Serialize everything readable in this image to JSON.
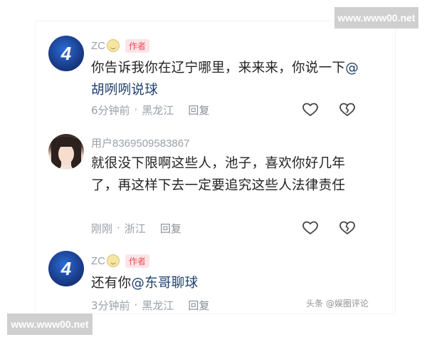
{
  "watermarks": {
    "top": "www.www00.net",
    "bottom": "www.www00.net",
    "source": "头条 @娱圈评论"
  },
  "comments": [
    {
      "username": "ZC",
      "badge": "作者",
      "text_plain": "你告诉我你在辽宁哪里，来来来，你说一下",
      "mention": "@胡咧咧说球",
      "time": "6分钟前",
      "location": "黑龙江",
      "reply_label": "回复",
      "avatar_text": "4"
    },
    {
      "username": "用户8369509583867",
      "badge": "",
      "text_plain": "就很没下限啊这些人，池子，喜欢你好几年了，再这样下去一定要追究这些人法律责任",
      "mention": "",
      "time": "刚刚",
      "location": "浙江",
      "reply_label": "回复",
      "avatar_text": ""
    },
    {
      "username": "ZC",
      "badge": "作者",
      "text_plain": "还有你",
      "mention": "@东哥聊球",
      "time": "3分钟前",
      "location": "黑龙江",
      "reply_label": "回复",
      "avatar_text": "4"
    }
  ],
  "colors": {
    "username": "#9aa0aa",
    "badge_bg": "#fde4e6",
    "badge_fg": "#f04d5a",
    "text": "#222222",
    "mention": "#20406e"
  },
  "icons": {
    "like": "heart-outline-icon",
    "dislike": "broken-heart-icon"
  }
}
